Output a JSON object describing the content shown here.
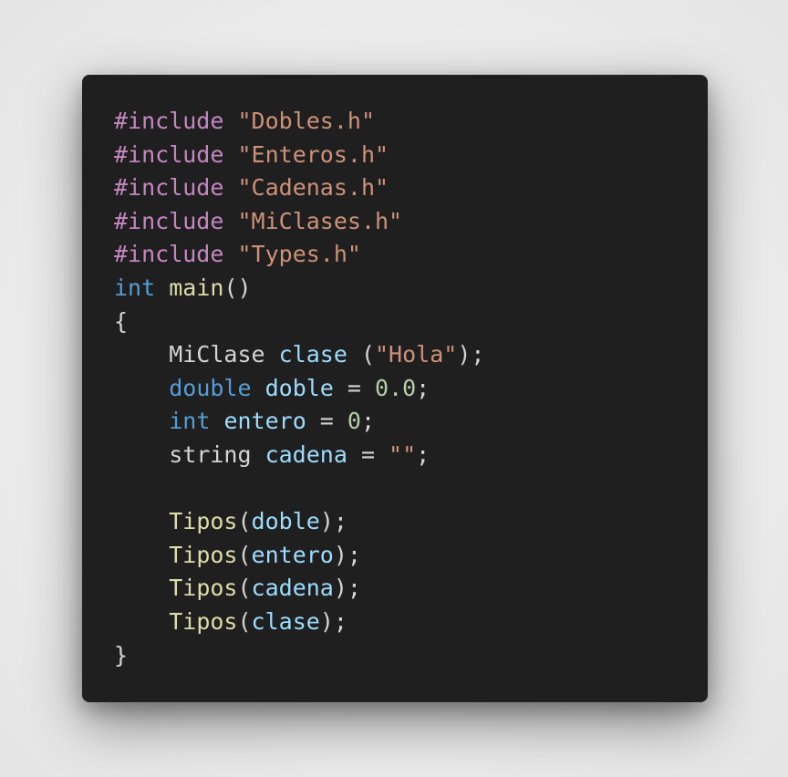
{
  "code": {
    "lines": [
      [
        {
          "t": "#include",
          "c": "directive"
        },
        {
          "t": " ",
          "c": "plain"
        },
        {
          "t": "\"Dobles.h\"",
          "c": "string"
        }
      ],
      [
        {
          "t": "#include",
          "c": "directive"
        },
        {
          "t": " ",
          "c": "plain"
        },
        {
          "t": "\"Enteros.h\"",
          "c": "string"
        }
      ],
      [
        {
          "t": "#include",
          "c": "directive"
        },
        {
          "t": " ",
          "c": "plain"
        },
        {
          "t": "\"Cadenas.h\"",
          "c": "string"
        }
      ],
      [
        {
          "t": "#include",
          "c": "directive"
        },
        {
          "t": " ",
          "c": "plain"
        },
        {
          "t": "\"MiClases.h\"",
          "c": "string"
        }
      ],
      [
        {
          "t": "#include",
          "c": "directive"
        },
        {
          "t": " ",
          "c": "plain"
        },
        {
          "t": "\"Types.h\"",
          "c": "string"
        }
      ],
      [
        {
          "t": "int",
          "c": "keyword"
        },
        {
          "t": " ",
          "c": "plain"
        },
        {
          "t": "main",
          "c": "function"
        },
        {
          "t": "()",
          "c": "plain"
        }
      ],
      [
        {
          "t": "{",
          "c": "plain"
        }
      ],
      [
        {
          "t": "    MiClase ",
          "c": "plain"
        },
        {
          "t": "clase",
          "c": "variable"
        },
        {
          "t": " (",
          "c": "plain"
        },
        {
          "t": "\"Hola\"",
          "c": "string"
        },
        {
          "t": ");",
          "c": "plain"
        }
      ],
      [
        {
          "t": "    ",
          "c": "plain"
        },
        {
          "t": "double",
          "c": "keyword"
        },
        {
          "t": " ",
          "c": "plain"
        },
        {
          "t": "doble",
          "c": "variable"
        },
        {
          "t": " = ",
          "c": "plain"
        },
        {
          "t": "0.0",
          "c": "number"
        },
        {
          "t": ";",
          "c": "plain"
        }
      ],
      [
        {
          "t": "    ",
          "c": "plain"
        },
        {
          "t": "int",
          "c": "keyword"
        },
        {
          "t": " ",
          "c": "plain"
        },
        {
          "t": "entero",
          "c": "variable"
        },
        {
          "t": " = ",
          "c": "plain"
        },
        {
          "t": "0",
          "c": "number"
        },
        {
          "t": ";",
          "c": "plain"
        }
      ],
      [
        {
          "t": "    string ",
          "c": "plain"
        },
        {
          "t": "cadena",
          "c": "variable"
        },
        {
          "t": " = ",
          "c": "plain"
        },
        {
          "t": "\"\"",
          "c": "string"
        },
        {
          "t": ";",
          "c": "plain"
        }
      ],
      [],
      [
        {
          "t": "    ",
          "c": "plain"
        },
        {
          "t": "Tipos",
          "c": "function"
        },
        {
          "t": "(",
          "c": "plain"
        },
        {
          "t": "doble",
          "c": "variable"
        },
        {
          "t": ");",
          "c": "plain"
        }
      ],
      [
        {
          "t": "    ",
          "c": "plain"
        },
        {
          "t": "Tipos",
          "c": "function"
        },
        {
          "t": "(",
          "c": "plain"
        },
        {
          "t": "entero",
          "c": "variable"
        },
        {
          "t": ");",
          "c": "plain"
        }
      ],
      [
        {
          "t": "    ",
          "c": "plain"
        },
        {
          "t": "Tipos",
          "c": "function"
        },
        {
          "t": "(",
          "c": "plain"
        },
        {
          "t": "cadena",
          "c": "variable"
        },
        {
          "t": ");",
          "c": "plain"
        }
      ],
      [
        {
          "t": "    ",
          "c": "plain"
        },
        {
          "t": "Tipos",
          "c": "function"
        },
        {
          "t": "(",
          "c": "plain"
        },
        {
          "t": "clase",
          "c": "variable"
        },
        {
          "t": ");",
          "c": "plain"
        }
      ],
      [
        {
          "t": "}",
          "c": "plain"
        }
      ]
    ]
  },
  "colors": {
    "page_background": "#ececec",
    "card_background": "#1f1f1f",
    "directive": "#c586c0",
    "string": "#ce9178",
    "keyword": "#569cd6",
    "function": "#dcdcaa",
    "variable": "#9cdcfe",
    "number": "#b5cea8",
    "plain": "#d4d4d4"
  }
}
